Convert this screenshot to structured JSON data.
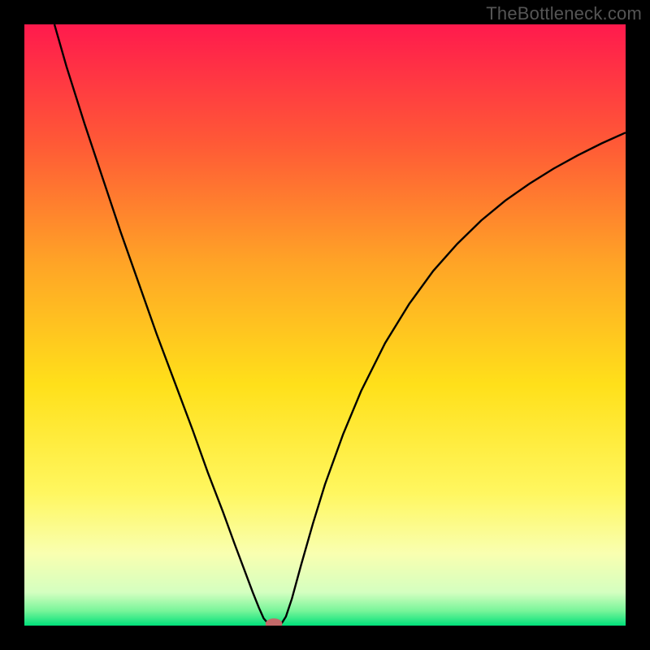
{
  "watermark": "TheBottleneck.com",
  "chart_data": {
    "type": "line",
    "title": "",
    "xlabel": "",
    "ylabel": "",
    "xlim": [
      0,
      100
    ],
    "ylim": [
      0,
      100
    ],
    "grid": false,
    "legend": false,
    "background_gradient_stops": [
      {
        "offset": 0.0,
        "color": "#ff1a4d"
      },
      {
        "offset": 0.2,
        "color": "#ff5a36"
      },
      {
        "offset": 0.4,
        "color": "#ffa526"
      },
      {
        "offset": 0.6,
        "color": "#ffe01a"
      },
      {
        "offset": 0.78,
        "color": "#fff760"
      },
      {
        "offset": 0.88,
        "color": "#f9ffb0"
      },
      {
        "offset": 0.945,
        "color": "#d4ffc0"
      },
      {
        "offset": 0.975,
        "color": "#7af59a"
      },
      {
        "offset": 1.0,
        "color": "#00e07a"
      }
    ],
    "series": [
      {
        "name": "curve",
        "stroke": "#000000",
        "stroke_width": 2.4,
        "points": [
          [
            5.0,
            100.0
          ],
          [
            7.0,
            93.0
          ],
          [
            10.0,
            83.5
          ],
          [
            13.0,
            74.5
          ],
          [
            16.0,
            65.5
          ],
          [
            19.0,
            57.0
          ],
          [
            22.0,
            48.5
          ],
          [
            25.0,
            40.5
          ],
          [
            28.0,
            32.5
          ],
          [
            30.5,
            25.5
          ],
          [
            33.0,
            19.0
          ],
          [
            35.0,
            13.5
          ],
          [
            36.5,
            9.5
          ],
          [
            38.0,
            5.5
          ],
          [
            39.0,
            3.0
          ],
          [
            39.8,
            1.2
          ],
          [
            40.5,
            0.4
          ],
          [
            41.3,
            0.0
          ],
          [
            42.0,
            0.0
          ],
          [
            42.8,
            0.4
          ],
          [
            43.5,
            1.5
          ],
          [
            44.5,
            4.5
          ],
          [
            46.0,
            10.0
          ],
          [
            48.0,
            17.0
          ],
          [
            50.0,
            23.5
          ],
          [
            53.0,
            31.8
          ],
          [
            56.0,
            39.0
          ],
          [
            60.0,
            47.0
          ],
          [
            64.0,
            53.5
          ],
          [
            68.0,
            59.0
          ],
          [
            72.0,
            63.5
          ],
          [
            76.0,
            67.4
          ],
          [
            80.0,
            70.7
          ],
          [
            84.0,
            73.5
          ],
          [
            88.0,
            76.0
          ],
          [
            92.0,
            78.2
          ],
          [
            96.0,
            80.2
          ],
          [
            100.0,
            82.0
          ]
        ]
      }
    ],
    "marker": {
      "x": 41.5,
      "y": 0.3,
      "rx": 1.4,
      "ry": 0.9,
      "fill": "#c46a6a"
    }
  }
}
